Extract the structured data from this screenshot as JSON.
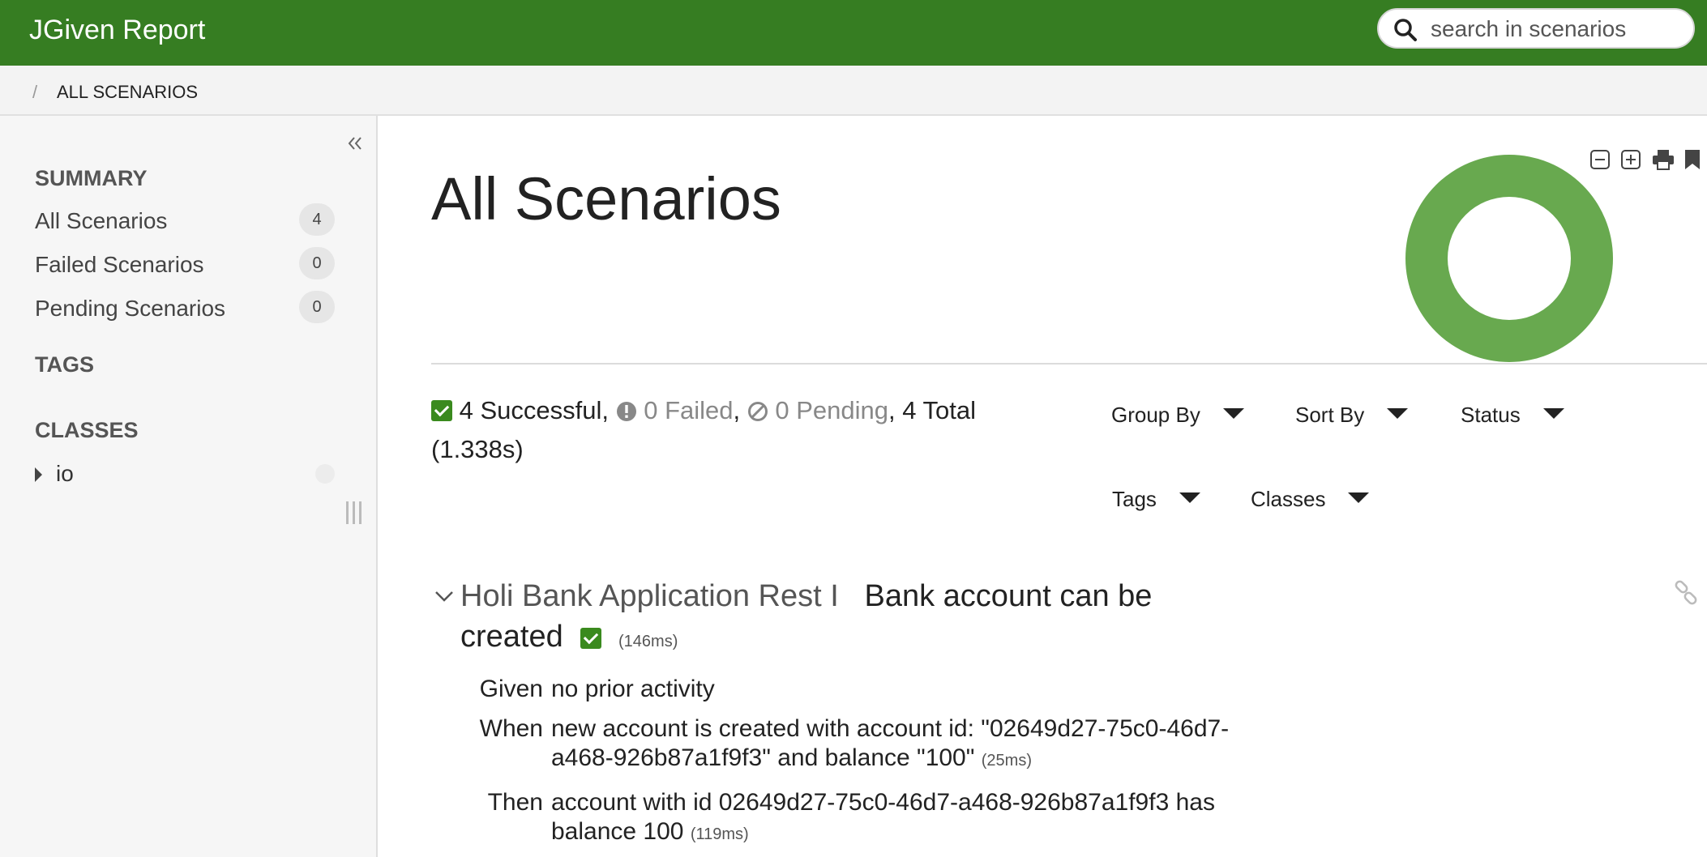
{
  "app": {
    "title": "JGiven Report",
    "brand_color": "#367d22"
  },
  "search": {
    "placeholder": "search in scenarios",
    "value": ""
  },
  "breadcrumb": {
    "separator": "/",
    "current": "ALL SCENARIOS"
  },
  "sidebar": {
    "summary_title": "SUMMARY",
    "items": [
      {
        "label": "All Scenarios",
        "count": "4"
      },
      {
        "label": "Failed Scenarios",
        "count": "0"
      },
      {
        "label": "Pending Scenarios",
        "count": "0"
      }
    ],
    "tags_title": "TAGS",
    "classes_title": "CLASSES",
    "classes": [
      {
        "label": "io"
      }
    ]
  },
  "main": {
    "title": "All Scenarios",
    "toolbar_icons": [
      "collapse-all-icon",
      "expand-all-icon",
      "print-icon",
      "bookmark-icon"
    ],
    "chart_data": {
      "type": "pie",
      "categories": [
        "Successful",
        "Failed",
        "Pending"
      ],
      "values": [
        4,
        0,
        0
      ],
      "colors": [
        "#68a94f",
        "#d9534f",
        "#999999"
      ]
    },
    "stats": {
      "successful": "4 Successful",
      "failed": "0 Failed",
      "pending": "0 Pending",
      "total": "4 Total",
      "duration": "(1.338s)"
    },
    "dropdowns": {
      "group_by": "Group By",
      "sort_by": "Sort By",
      "status": "Status",
      "tags": "Tags",
      "classes": "Classes"
    },
    "scenario": {
      "class_name": "Holi Bank Application Rest I",
      "name": "Bank account can be created",
      "duration": "(146ms)",
      "steps": [
        {
          "keyword": "Given",
          "text": "no prior activity",
          "duration": ""
        },
        {
          "keyword": "When",
          "text": "new account is created with account id: \"02649d27-75c0-46d7-a468-926b87a1f9f3\" and balance \"100\"",
          "duration": "(25ms)"
        },
        {
          "keyword": "Then",
          "text": "account with id 02649d27-75c0-46d7-a468-926b87a1f9f3 has balance 100",
          "duration": "(119ms)"
        }
      ]
    }
  }
}
